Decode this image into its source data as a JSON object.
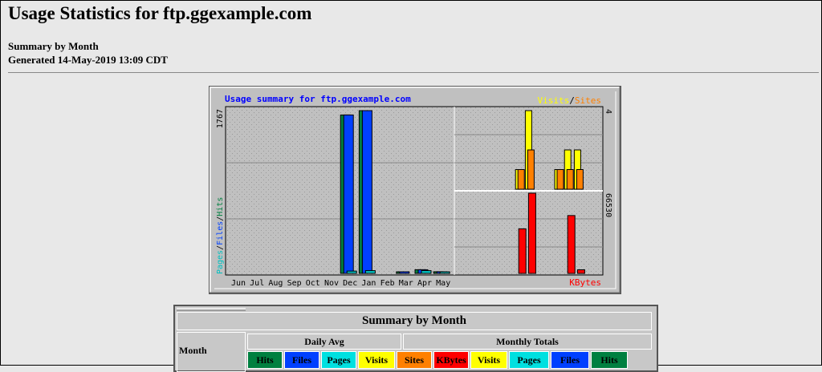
{
  "page": {
    "title": "Usage Statistics for ftp.ggexample.com",
    "subtitle": "Summary by Month",
    "generated": "Generated 14-May-2019 13:09 CDT"
  },
  "chart_data": {
    "type": "bar",
    "title": "Usage summary for ftp.ggexample.com",
    "categories": [
      "Jun",
      "Jul",
      "Aug",
      "Sep",
      "Oct",
      "Nov",
      "Dec",
      "Jan",
      "Feb",
      "Mar",
      "Apr",
      "May"
    ],
    "left_axis_max_label": "1767",
    "left_ylim": [
      0,
      1767
    ],
    "left_legend": [
      "Pages",
      "Files",
      "Hits"
    ],
    "left_series": [
      {
        "name": "Hits",
        "color": "#008040",
        "values": [
          0,
          0,
          0,
          0,
          0,
          0,
          1720,
          1767,
          0,
          2,
          40,
          18
        ]
      },
      {
        "name": "Files",
        "color": "#0040ff",
        "values": [
          0,
          0,
          0,
          0,
          0,
          0,
          1720,
          1767,
          0,
          2,
          40,
          18
        ]
      },
      {
        "name": "Pages",
        "color": "#00c0c0",
        "values": [
          0,
          0,
          0,
          0,
          0,
          0,
          25,
          30,
          0,
          0,
          30,
          10
        ]
      }
    ],
    "right_top_max_label": "4",
    "right_top_ylim": [
      0,
      4
    ],
    "right_top_legend": [
      "Visits",
      "Sites"
    ],
    "right_top_series": [
      {
        "name": "Visits",
        "color": "#ffff00",
        "values": [
          0,
          0,
          0,
          0,
          0,
          0,
          1,
          4,
          0,
          0,
          1,
          2,
          2
        ]
      },
      {
        "name": "Sites",
        "color": "#ff8000",
        "values": [
          0,
          0,
          0,
          0,
          0,
          0,
          1,
          2,
          0,
          0,
          1,
          1,
          1
        ]
      }
    ],
    "right_bottom_max_label": "66530",
    "right_bottom_ylim": [
      0,
      66530
    ],
    "right_bottom_legend": [
      "KBytes"
    ],
    "right_bottom_series": [
      {
        "name": "KBytes",
        "color": "#ff0000",
        "values": [
          0,
          0,
          0,
          0,
          0,
          0,
          37000,
          66530,
          0,
          0,
          0,
          48000,
          3000
        ]
      }
    ],
    "separator": "/"
  },
  "summary_table": {
    "title": "Summary by Month",
    "month_header": "Month",
    "group_daily": "Daily Avg",
    "group_monthly": "Monthly Totals",
    "columns": [
      {
        "label": "Hits",
        "color": "#008040"
      },
      {
        "label": "Files",
        "color": "#0040ff"
      },
      {
        "label": "Pages",
        "color": "#00e0e0"
      },
      {
        "label": "Visits",
        "color": "#ffff00"
      },
      {
        "label": "Sites",
        "color": "#ff8000"
      },
      {
        "label": "KBytes",
        "color": "#ff0000"
      },
      {
        "label": "Visits",
        "color": "#ffff00"
      },
      {
        "label": "Pages",
        "color": "#00e0e0"
      },
      {
        "label": "Files",
        "color": "#0040ff"
      },
      {
        "label": "Hits",
        "color": "#008040"
      }
    ]
  }
}
